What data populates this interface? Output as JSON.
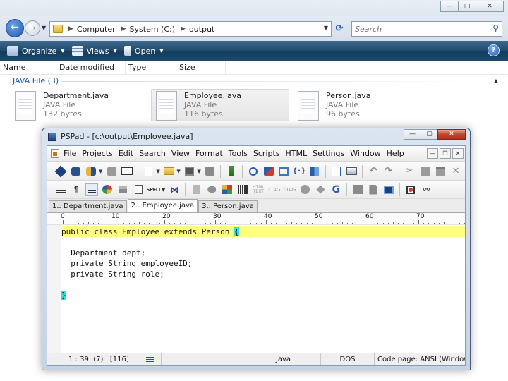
{
  "explorer": {
    "back_icon": "back-arrow-icon",
    "forward_icon": "forward-arrow-icon",
    "breadcrumb": [
      "Computer",
      "System (C:)",
      "output"
    ],
    "search_placeholder": "Search",
    "toolbar": {
      "organize": "Organize",
      "views": "Views",
      "open": "Open"
    },
    "columns": [
      "Name",
      "Date modified",
      "Type",
      "Size"
    ],
    "group_label": "JAVA File (3)",
    "files": [
      {
        "name": "Department.java",
        "type": "JAVA File",
        "size": "132 bytes",
        "selected": false
      },
      {
        "name": "Employee.java",
        "type": "JAVA File",
        "size": "116 bytes",
        "selected": true
      },
      {
        "name": "Person.java",
        "type": "JAVA File",
        "size": "96 bytes",
        "selected": false
      }
    ]
  },
  "pspad": {
    "title": "PSPad - [c:\\output\\Employee.java]",
    "menu": [
      "File",
      "Projects",
      "Edit",
      "Search",
      "View",
      "Format",
      "Tools",
      "Scripts",
      "HTML",
      "Settings",
      "Window",
      "Help"
    ],
    "tabs": [
      "1.. Department.java",
      "2.. Employee.java",
      "3.. Person.java"
    ],
    "active_tab": 1,
    "ruler_labels": [
      "0",
      "10",
      "20",
      "30",
      "40",
      "50",
      "60",
      "70"
    ],
    "code": [
      {
        "before": "public class Employee extends Person ",
        "brace": "{",
        "current": true
      },
      {
        "before": "",
        "brace": "",
        "current": false
      },
      {
        "before": "  Department dept;",
        "brace": "",
        "current": false
      },
      {
        "before": "  private String employeeID;",
        "brace": "",
        "current": false
      },
      {
        "before": "  private String role;",
        "brace": "",
        "current": false
      },
      {
        "before": "",
        "brace": "",
        "current": false
      },
      {
        "before": "",
        "brace": "}",
        "current": false
      }
    ],
    "status": {
      "position": "1 : 39",
      "lines": "(7)",
      "bytes": "[116]",
      "language": "Java",
      "line_ending": "DOS",
      "codepage": "Code page: ANSI (Window"
    }
  },
  "colors": {
    "command_bar": "#1f4a6d",
    "current_line": "#ffff80",
    "brace_match": "#33e0e0",
    "group_heading": "#1e5aa8"
  }
}
